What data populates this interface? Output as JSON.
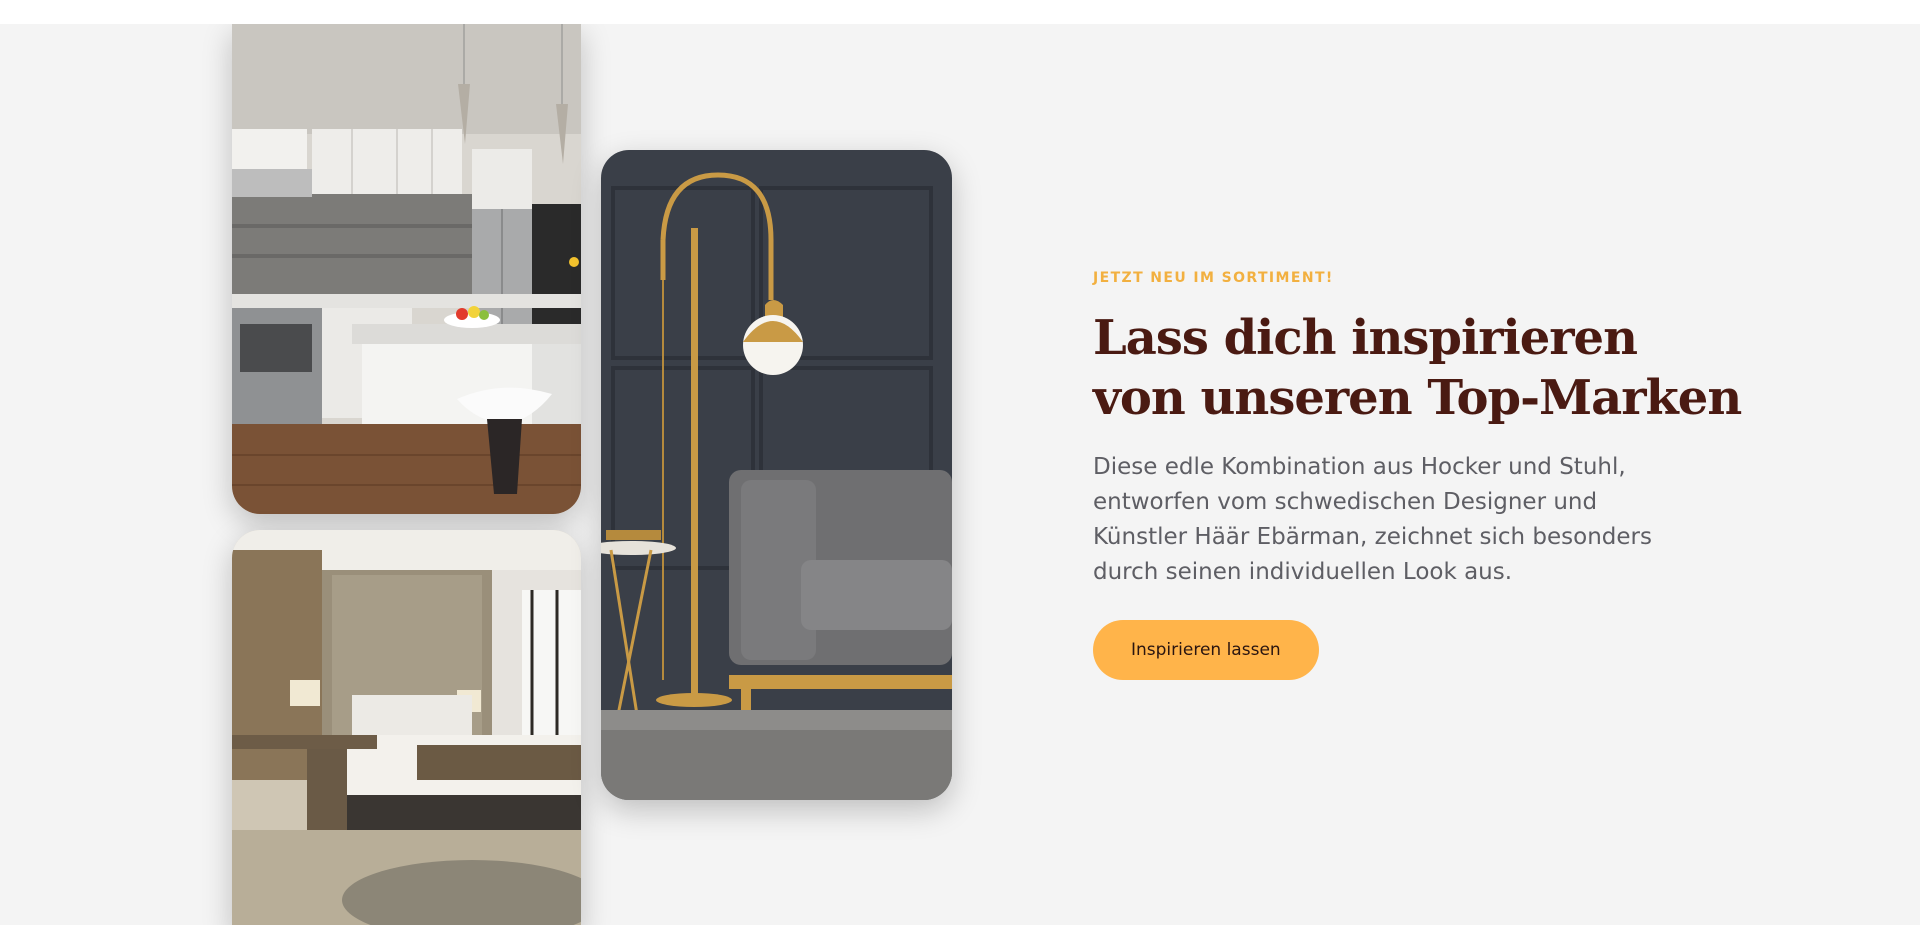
{
  "hero": {
    "eyebrow": "JETZT NEU IM SORTIMENT!",
    "headline_line1": "Lass dich inspirieren",
    "headline_line2": "von unseren Top-Marken",
    "body": "Diese edle Kombination aus Hocker und Stuhl, entworfen vom schwedischen Designer und Künstler Häär Ebärman, zeichnet sich besonders durch seinen individuellen Look aus.",
    "cta_label": "Inspirieren lassen"
  },
  "images": {
    "kitchen": "kitchen-interior-photo",
    "bedroom": "bedroom-interior-photo",
    "lamp": "floor-lamp-and-sofa-photo"
  },
  "colors": {
    "background": "#f4f4f4",
    "eyebrow": "#f2b040",
    "headline": "#4a1a12",
    "body": "#5e5e64",
    "button": "#ffb44a"
  }
}
